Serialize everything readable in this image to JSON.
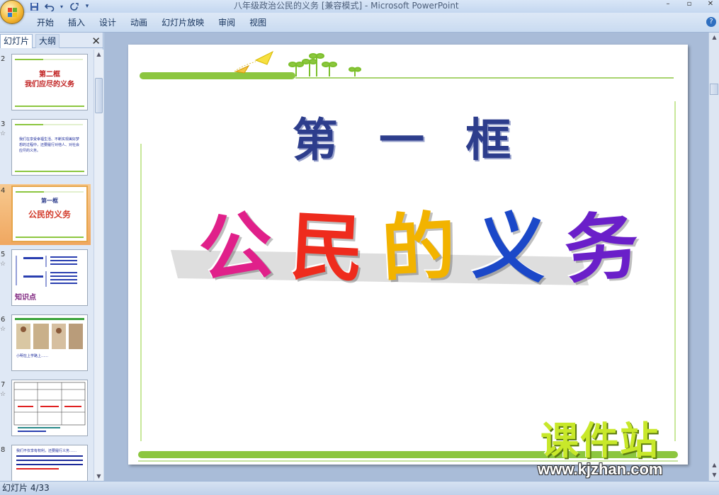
{
  "titlebar": {
    "title": "八年级政治公民的义务 [兼容模式] - Microsoft PowerPoint"
  },
  "qat": {
    "save": "save-icon",
    "undo": "undo-icon",
    "redo": "redo-icon",
    "more": "▾"
  },
  "ribbon": {
    "tabs": [
      {
        "label": "开始"
      },
      {
        "label": "插入"
      },
      {
        "label": "设计"
      },
      {
        "label": "动画"
      },
      {
        "label": "幻灯片放映"
      },
      {
        "label": "审阅"
      },
      {
        "label": "视图"
      }
    ],
    "help": "?"
  },
  "panel": {
    "tab_slides": "幻灯片",
    "tab_outline": "大纲",
    "close": "✕",
    "thumbnails": [
      {
        "number": "2",
        "star": "",
        "title1": "第二框",
        "title2": "我们应尽的义务"
      },
      {
        "number": "3",
        "star": "☆",
        "text": "我们在享受幸福生活、不断实现美好梦想的过程中，还要履行对他人、对社会应尽的义务。"
      },
      {
        "number": "4",
        "star": "",
        "title1": "第一框",
        "title2": "公民的义务"
      },
      {
        "number": "5",
        "star": "☆",
        "label": "知识点"
      },
      {
        "number": "6",
        "star": "☆",
        "caption": "小明在上学路上……"
      },
      {
        "number": "7",
        "star": "☆"
      },
      {
        "number": "8",
        "star": "",
        "text": "我们不仅享有权利，还要履行义务……"
      }
    ]
  },
  "slide": {
    "heading": "第 一 框",
    "title_chars": [
      "公",
      "民",
      "的",
      "义",
      "务"
    ],
    "title_colors": [
      "#e0208a",
      "#ee2b1d",
      "#f2b300",
      "#1b48c8",
      "#6a1fc9"
    ]
  },
  "watermark": {
    "brand": "课件站",
    "url": "www.kjzhan.com"
  },
  "status": {
    "slide_count": "幻灯片 4/33"
  },
  "colors": {
    "accent_green": "#8cc63f",
    "heading_blue": "#2d3d8c",
    "selected_thumb": "#f0a760"
  }
}
